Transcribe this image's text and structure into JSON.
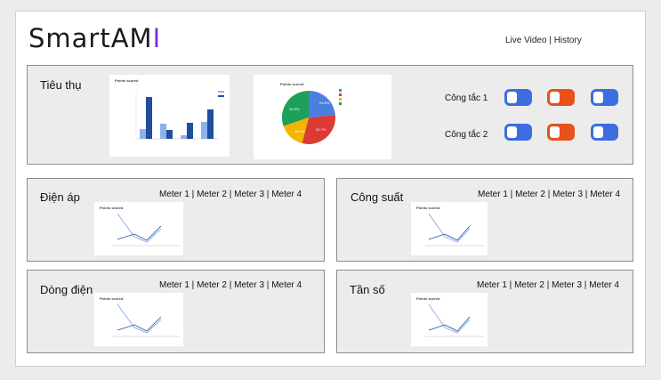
{
  "brand": {
    "name_main": "SmartAM",
    "name_accent": "I"
  },
  "topnav": {
    "live_video": "Live Video",
    "sep": " | ",
    "history": "History"
  },
  "consumption": {
    "title": "Tiêu thụ",
    "bar_chart_title": "Points scored",
    "pie_chart_title": "Points scored",
    "pie_labels": [
      "21.8%",
      "32.7%",
      "16.4%",
      "34.5%"
    ],
    "switches": [
      {
        "label": "Công tắc 1",
        "states": [
          "blue",
          "orange",
          "blue"
        ]
      },
      {
        "label": "Công tắc 2",
        "states": [
          "blue",
          "orange",
          "blue"
        ]
      }
    ]
  },
  "meter_tabs": [
    "Meter 1",
    "Meter 2",
    "Meter 3",
    "Meter 4"
  ],
  "meter_sep": " | ",
  "panels": [
    {
      "title": "Điện áp",
      "chart_title": "Points scored"
    },
    {
      "title": "Công suất",
      "chart_title": "Points scored"
    },
    {
      "title": "Dòng điện",
      "chart_title": "Points scored"
    },
    {
      "title": "Tần số",
      "chart_title": "Points scored"
    }
  ],
  "colors": {
    "blue": "#3d6ee0",
    "orange": "#e8501c",
    "pie": [
      "#4a7fe0",
      "#dc3a34",
      "#f4b400",
      "#1fa05a"
    ]
  }
}
